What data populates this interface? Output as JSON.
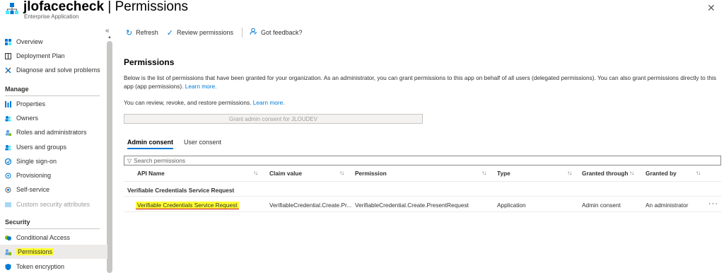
{
  "header": {
    "app_name": "jlofacecheck",
    "separator": " | ",
    "page": "Permissions",
    "subtitle": "Enterprise Application",
    "more": "···",
    "close": "✕"
  },
  "sidebar": {
    "collapse": "«",
    "items_top": [
      {
        "label": "Overview",
        "icon": "overview-icon"
      },
      {
        "label": "Deployment Plan",
        "icon": "book-icon"
      },
      {
        "label": "Diagnose and solve problems",
        "icon": "wrench-icon"
      }
    ],
    "manage_heading": "Manage",
    "manage_items": [
      {
        "label": "Properties",
        "icon": "properties-icon"
      },
      {
        "label": "Owners",
        "icon": "owners-icon"
      },
      {
        "label": "Roles and administrators",
        "icon": "roles-icon"
      },
      {
        "label": "Users and groups",
        "icon": "users-icon"
      },
      {
        "label": "Single sign-on",
        "icon": "sso-icon"
      },
      {
        "label": "Provisioning",
        "icon": "provisioning-icon"
      },
      {
        "label": "Self-service",
        "icon": "self-service-icon"
      },
      {
        "label": "Custom security attributes",
        "icon": "custom-attributes-icon"
      }
    ],
    "security_heading": "Security",
    "security_items": [
      {
        "label": "Conditional Access",
        "icon": "conditional-access-icon"
      },
      {
        "label": "Permissions",
        "icon": "permissions-icon"
      },
      {
        "label": "Token encryption",
        "icon": "shield-icon"
      }
    ]
  },
  "toolbar": {
    "refresh": "Refresh",
    "review": "Review permissions",
    "feedback": "Got feedback?"
  },
  "main": {
    "title": "Permissions",
    "desc": "Below is the list of permissions that have been granted for your organization. As an administrator, you can grant permissions to this app on behalf of all users (delegated permissions). You can also grant permissions directly to this app (app permissions).",
    "learn_more_1": "Learn more.",
    "desc2": "You can review, revoke, and restore permissions.",
    "learn_more_2": "Learn more.",
    "grant_button": "Grant admin consent for JLOUDEV",
    "tabs": [
      "Admin consent",
      "User consent"
    ],
    "search_placeholder": "Search permissions",
    "columns": [
      "API Name",
      "Claim value",
      "Permission",
      "Type",
      "Granted through",
      "Granted by"
    ],
    "sort_glyph": "↑↓",
    "group": "Verifiable Credentials Service Request",
    "row": {
      "api_name": "Verifiable Credentials Service Request",
      "claim_value": "VerifiableCredential.Create.Pr...",
      "permission": "VerifiableCredential.Create.PresentRequest",
      "type": "Application",
      "granted_through": "Admin consent",
      "granted_by": "An administrator",
      "more": "···"
    }
  },
  "colors": {
    "accent": "#0078d4",
    "highlight": "#ffff33"
  }
}
